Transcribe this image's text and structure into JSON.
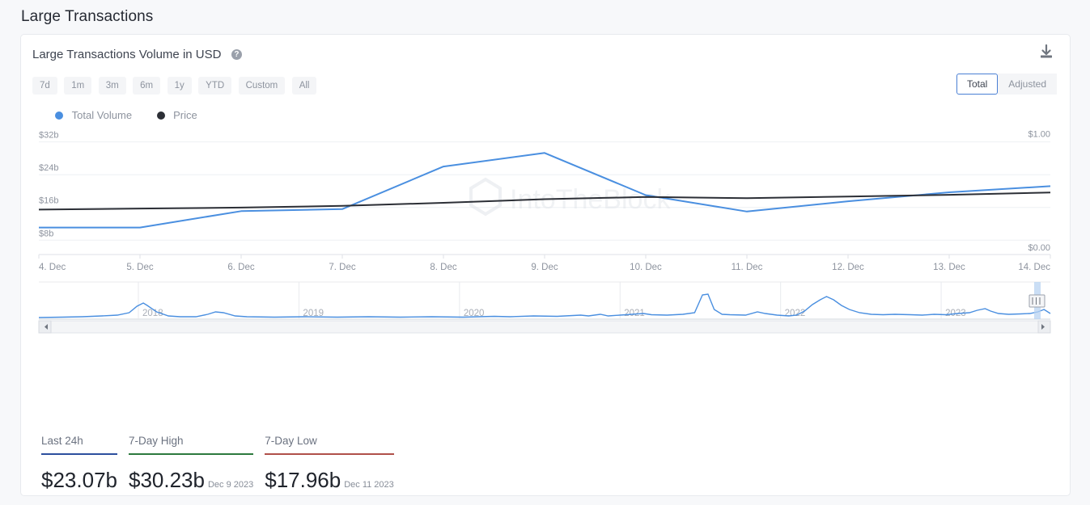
{
  "page": {
    "title": "Large Transactions"
  },
  "card": {
    "title": "Large Transactions Volume in USD",
    "help_icon": "question-mark-circle-icon",
    "download_icon": "download-icon"
  },
  "ranges": {
    "options": [
      "7d",
      "1m",
      "3m",
      "6m",
      "1y",
      "YTD",
      "Custom",
      "All"
    ],
    "selected": "7d"
  },
  "view_toggle": {
    "options": [
      "Total",
      "Adjusted"
    ],
    "selected": "Total"
  },
  "legend": [
    {
      "label": "Total Volume",
      "color": "#4a8fe0"
    },
    {
      "label": "Price",
      "color": "#2c2f36"
    }
  ],
  "watermark": {
    "text": "IntoTheBlock"
  },
  "navigator": {
    "year_labels": [
      "2018",
      "2019",
      "2020",
      "2021",
      "2022",
      "2023"
    ],
    "left_arrow": "scroll-left-arrow-icon",
    "right_arrow": "scroll-right-arrow-icon",
    "handle": "range-selection-handle"
  },
  "stats": [
    {
      "label": "Last 24h",
      "value": "$23.07b",
      "date": "",
      "color": "#2c4f9e"
    },
    {
      "label": "7-Day High",
      "value": "$30.23b",
      "date": "Dec 9 2023",
      "color": "#2d7a3e"
    },
    {
      "label": "7-Day Low",
      "value": "$17.96b",
      "date": "Dec 11 2023",
      "color": "#b0504a"
    }
  ],
  "chart_data": {
    "type": "line",
    "title": "Large Transactions Volume in USD",
    "xlabel": "",
    "ylabel": "",
    "grid": true,
    "legend_position": "top-left",
    "categories": [
      "4. Dec",
      "5. Dec",
      "6. Dec",
      "7. Dec",
      "8. Dec",
      "9. Dec",
      "10. Dec",
      "11. Dec",
      "12. Dec",
      "13. Dec",
      "14. Dec"
    ],
    "y_axis_left": {
      "tick_labels": [
        "$8b",
        "$16b",
        "$24b",
        "$32b"
      ],
      "tick_values": [
        8,
        16,
        24,
        32
      ],
      "ylim": [
        4.5,
        34.5
      ],
      "unit": "billion USD"
    },
    "y_axis_right": {
      "tick_labels": [
        "$0.00",
        "$1.00"
      ],
      "tick_values": [
        0.0,
        1.0
      ],
      "ylim": [
        0.0,
        1.08
      ],
      "unit": "USD"
    },
    "series": [
      {
        "name": "Total Volume",
        "color": "#4a8fe0",
        "axis": "left",
        "values": [
          11.1,
          11.1,
          15.1,
          15.6,
          26.0,
          29.3,
          19.0,
          15.0,
          17.5,
          19.7,
          21.2
        ]
      },
      {
        "name": "Price",
        "color": "#2c2f36",
        "axis": "right",
        "values": [
          0.395,
          0.404,
          0.413,
          0.428,
          0.455,
          0.487,
          0.506,
          0.495,
          0.51,
          0.525,
          0.545
        ]
      }
    ],
    "navigator_series": {
      "name": "Total Volume history",
      "color": "#4a8fe0",
      "x_range": [
        "2017",
        "2023"
      ],
      "year_ticks": [
        "2018",
        "2019",
        "2020",
        "2021",
        "2022",
        "2023"
      ]
    }
  }
}
